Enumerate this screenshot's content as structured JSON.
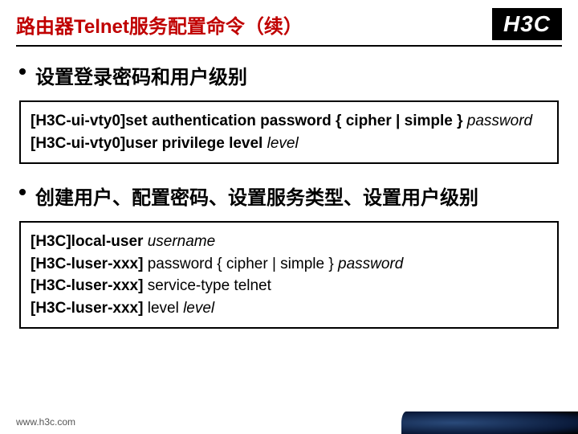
{
  "header": {
    "title": "路由器Telnet服务配置命令（续）",
    "logo": "H3C"
  },
  "section1": {
    "title": "设置登录密码和用户级别",
    "code_parts": {
      "p1": "[H3C-ui-vty0]set authentication password { cipher | simple }",
      "p1_arg": " password",
      "p2": "[H3C-ui-vty0]user privilege level",
      "p2_arg": " level"
    }
  },
  "section2": {
    "title": "创建用户、配置密码、设置服务类型、设置用户级别",
    "lines": {
      "l1a": "[H3C]local-user",
      "l1b": " username",
      "l2a": "[H3C-luser-xxx]",
      "l2b": " password { cipher | simple }",
      "l2c": " password",
      "l3a": "[H3C-luser-xxx]",
      "l3b": " service-type telnet",
      "l4a": "[H3C-luser-xxx]",
      "l4b": " level",
      "l4c": " level"
    }
  },
  "footer": {
    "url": "www.h3c.com"
  }
}
